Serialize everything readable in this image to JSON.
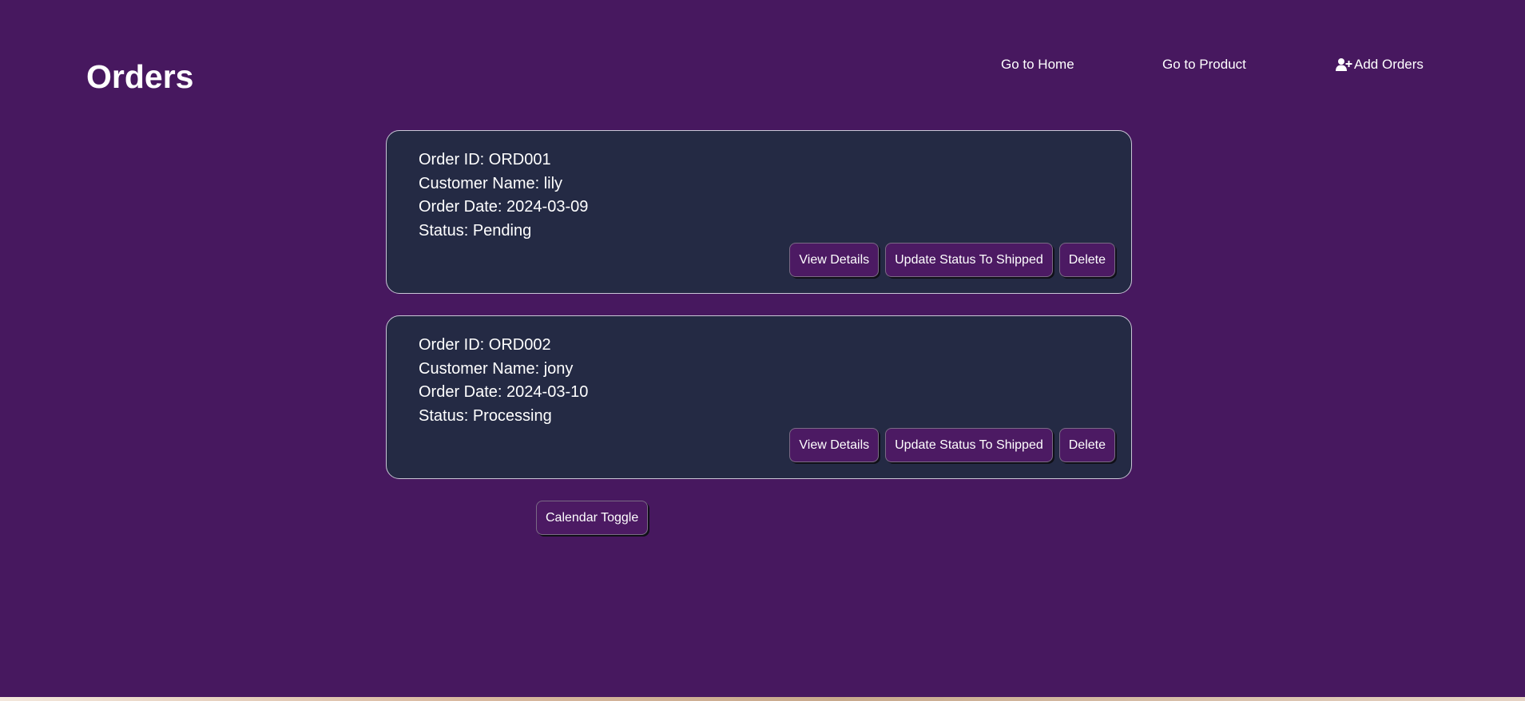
{
  "header": {
    "title": "Orders"
  },
  "nav": {
    "home": "Go to Home",
    "product": "Go to Product",
    "add_orders": "Add Orders",
    "add_orders_icon": "user-plus-icon"
  },
  "orders": [
    {
      "id_line": "Order ID: ORD001",
      "customer_line": "Customer Name: lily",
      "date_line": "Order Date: 2024-03-09",
      "status_line": "Status: Pending"
    },
    {
      "id_line": "Order ID: ORD002",
      "customer_line": "Customer Name: jony",
      "date_line": "Order Date: 2024-03-10",
      "status_line": "Status: Processing"
    }
  ],
  "actions": {
    "view": "View Details",
    "update": "Update Status To Shipped",
    "delete": "Delete"
  },
  "calendar": {
    "toggle_label": "Calendar Toggle"
  },
  "colors": {
    "background": "#47185f",
    "card": "#242a44",
    "button": "#4c1a63"
  }
}
